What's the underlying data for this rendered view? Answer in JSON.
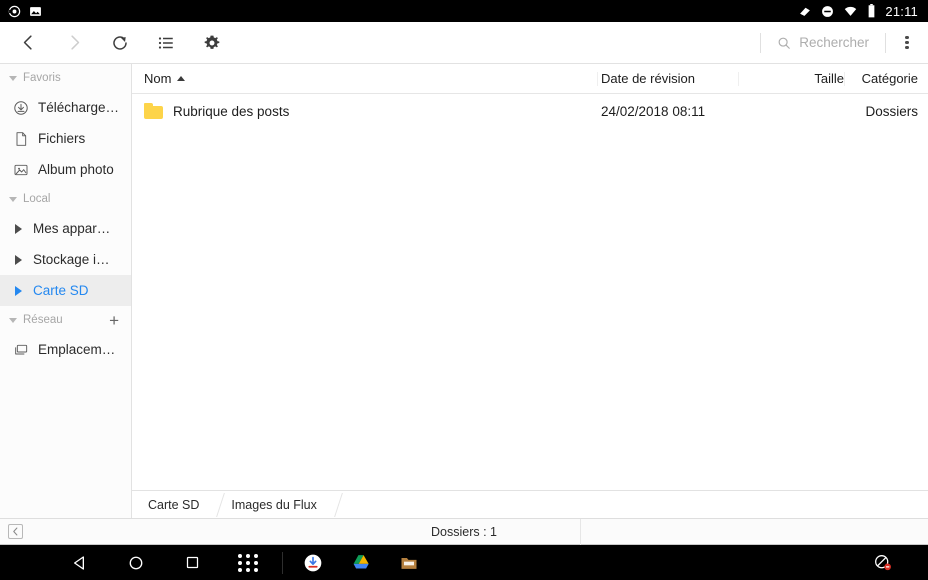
{
  "status_bar": {
    "left_icons": [
      "camera-icon",
      "photo-icon"
    ],
    "right_icons": [
      "cast-icon",
      "do-not-disturb-icon",
      "wifi-icon",
      "battery-icon"
    ],
    "clock": "21:11"
  },
  "toolbar": {
    "back_label": "Précédent",
    "forward_label": "Suivant",
    "refresh_label": "Actualiser",
    "list_label": "Affichage liste",
    "settings_label": "Paramètres",
    "search_placeholder": "Rechercher",
    "overflow_label": "Plus d'options"
  },
  "sidebar": {
    "groups": [
      {
        "title": "Favoris",
        "has_add": false,
        "items": [
          {
            "label": "Télécharge…",
            "icon": "download-circle-icon",
            "selected": false,
            "expandable": false
          },
          {
            "label": "Fichiers",
            "icon": "document-icon",
            "selected": false,
            "expandable": false
          },
          {
            "label": "Album photo",
            "icon": "image-icon",
            "selected": false,
            "expandable": false
          }
        ]
      },
      {
        "title": "Local",
        "has_add": false,
        "items": [
          {
            "label": "Mes appar…",
            "icon": "",
            "selected": false,
            "expandable": true
          },
          {
            "label": "Stockage i…",
            "icon": "",
            "selected": false,
            "expandable": true
          },
          {
            "label": "Carte SD",
            "icon": "",
            "selected": true,
            "expandable": true
          }
        ]
      },
      {
        "title": "Réseau",
        "has_add": true,
        "add_label": "+",
        "items": [
          {
            "label": "Emplacem…",
            "icon": "network-icon",
            "selected": false,
            "expandable": false
          }
        ]
      }
    ]
  },
  "file_pane": {
    "columns": [
      {
        "key": "nom",
        "label": "Nom",
        "sort": "asc"
      },
      {
        "key": "date",
        "label": "Date de révision",
        "sort": ""
      },
      {
        "key": "taille",
        "label": "Taille",
        "sort": ""
      },
      {
        "key": "categorie",
        "label": "Catégorie",
        "sort": ""
      }
    ],
    "rows": [
      {
        "icon": "folder-icon",
        "nom": "Rubrique des posts",
        "date": "24/02/2018 08:11",
        "taille": "",
        "categorie": "Dossiers"
      }
    ],
    "tabs": [
      {
        "label": "Carte SD",
        "active": true
      },
      {
        "label": "Images du Flux",
        "active": false
      }
    ]
  },
  "status_line": {
    "collapse_icon": "chevron-left-icon",
    "count_text": "Dossiers : 1"
  },
  "nav_bar": {
    "buttons": [
      {
        "name": "back-triangle-icon",
        "label": "Retour"
      },
      {
        "name": "home-circle-icon",
        "label": "Accueil"
      },
      {
        "name": "recents-square-icon",
        "label": "Applications récentes"
      },
      {
        "name": "app-drawer-icon",
        "label": "Toutes les applications"
      }
    ],
    "apps": [
      {
        "name": "downloads-app-icon",
        "label": "Téléchargements"
      },
      {
        "name": "google-drive-icon",
        "label": "Google Drive"
      },
      {
        "name": "file-manager-icon",
        "label": "Gestionnaire de fichiers"
      }
    ],
    "right": {
      "name": "no-notifications-icon",
      "label": "Notifications bloquées"
    }
  },
  "colors": {
    "accent": "#2488f0",
    "folder": "#fdd449",
    "selection_bg": "#ededed",
    "toolbar_bg": "#ffffff",
    "sidebar_bg": "#fcfcfc",
    "system_bar": "#000000"
  }
}
